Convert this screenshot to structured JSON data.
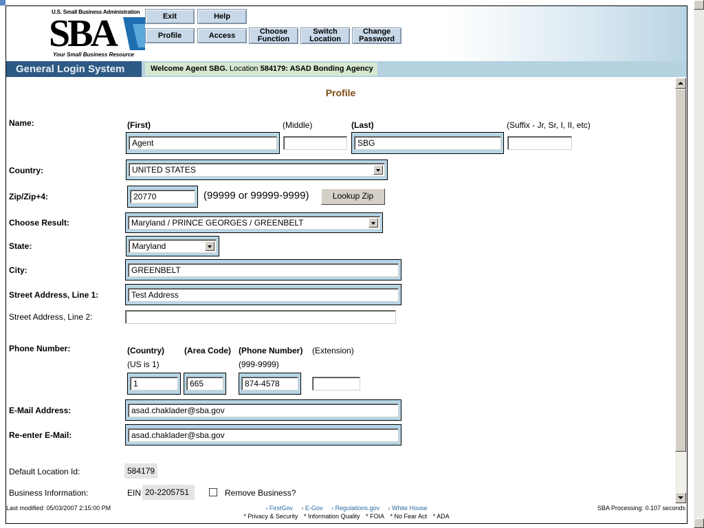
{
  "header": {
    "logo_top": "U.S. Small Business Administration",
    "logo_big": "SBA",
    "logo_bottom": "Your Small Business Resource",
    "buttons": {
      "exit": "Exit",
      "help": "Help",
      "profile": "Profile",
      "access": "Access",
      "choose_function": "Choose Function",
      "switch_location": "Switch Location",
      "change_password": "Change Password"
    }
  },
  "titlebar": {
    "app_name": "General Login System",
    "welcome_prefix": "Welcome Agent SBG.",
    "location_label": "Location",
    "location_value": "584179: ASAD Bonding Agency"
  },
  "page": {
    "title": "Profile",
    "name": {
      "label": "Name:",
      "first_label": "(First)",
      "middle_label": "(Middle)",
      "last_label": "(Last)",
      "suffix_label": "(Suffix - Jr, Sr, I, II, etc)",
      "first": "Agent",
      "middle": "",
      "last": "SBG",
      "suffix": ""
    },
    "country": {
      "label": "Country:",
      "value": "UNITED STATES"
    },
    "zip": {
      "label": "Zip/Zip+4:",
      "value": "20770",
      "hint": "(99999 or 99999-9999)",
      "lookup": "Lookup Zip"
    },
    "choose_result": {
      "label": "Choose Result:",
      "value": "Maryland / PRINCE GEORGES / GREENBELT"
    },
    "state": {
      "label": "State:",
      "value": "Maryland"
    },
    "city": {
      "label": "City:",
      "value": "GREENBELT"
    },
    "street1": {
      "label": "Street Address, Line 1:",
      "value": "Test Address"
    },
    "street2": {
      "label": "Street Address, Line 2:",
      "value": ""
    },
    "phone": {
      "label": "Phone Number:",
      "country_label": "(Country)",
      "country_hint": "(US is 1)",
      "area_label": "(Area Code)",
      "number_label": "(Phone Number)",
      "number_hint": "(999-9999)",
      "ext_label": "(Extension)",
      "country": "1",
      "area": "665",
      "number": "874-4578",
      "ext": ""
    },
    "email": {
      "label": "E-Mail Address:",
      "value": "asad.chaklader@sba.gov"
    },
    "email2": {
      "label": "Re-enter E-Mail:",
      "value": "asad.chaklader@sba.gov"
    },
    "default_location": {
      "label": "Default Location Id:",
      "value": "584179"
    },
    "business": {
      "label": "Business Information:",
      "ein_label": "EIN",
      "ein": "20-2205751",
      "remove_label": "Remove Business?"
    }
  },
  "footer": {
    "last_modified": "Last modified: 05/03/2007 2:15:00 PM",
    "links": [
      "› FirstGov",
      "› E-Gov",
      "› Regulations.gov",
      "› White House"
    ],
    "links2": [
      "* Privacy & Security",
      "* Information Quality",
      "* FOIA",
      "* No Fear Act",
      "* ADA"
    ],
    "processing": "SBA Processing:  0.107 seconds"
  }
}
